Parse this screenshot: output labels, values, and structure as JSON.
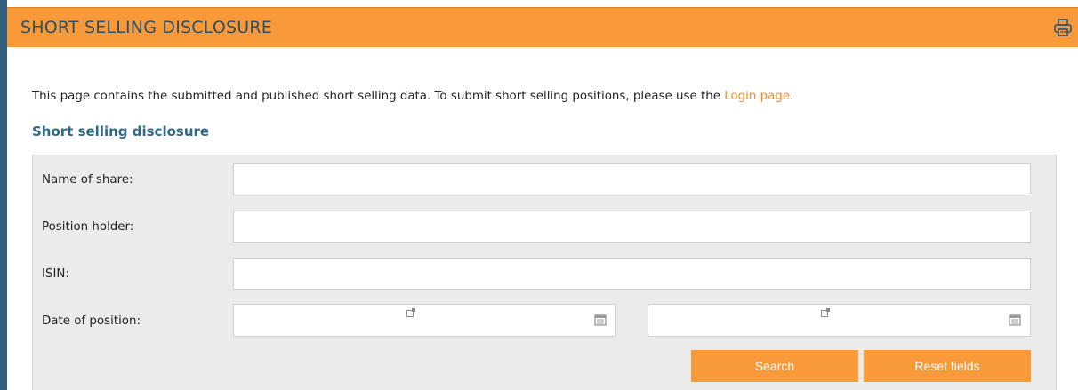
{
  "header": {
    "title": "SHORT SELLING DISCLOSURE",
    "print_icon": "printer-icon"
  },
  "intro": {
    "text_before": "This page contains the submitted and published short selling data. To submit short selling positions, please use the ",
    "link_text": "Login page",
    "text_after": "."
  },
  "section_title": "Short selling disclosure",
  "form": {
    "fields": [
      {
        "label": "Name of share:",
        "value": ""
      },
      {
        "label": "Position holder:",
        "value": ""
      },
      {
        "label": "ISIN:",
        "value": ""
      }
    ],
    "date": {
      "label": "Date of position:",
      "from_value": "",
      "to_value": "",
      "calendar_icon": "calendar-icon"
    },
    "buttons": {
      "search": "Search",
      "reset": "Reset fields"
    }
  },
  "colors": {
    "accent": "#f8993a",
    "title_text": "#2f4f66",
    "section_title": "#2e6a86",
    "link": "#f28c28",
    "form_bg": "#ebebeb"
  }
}
